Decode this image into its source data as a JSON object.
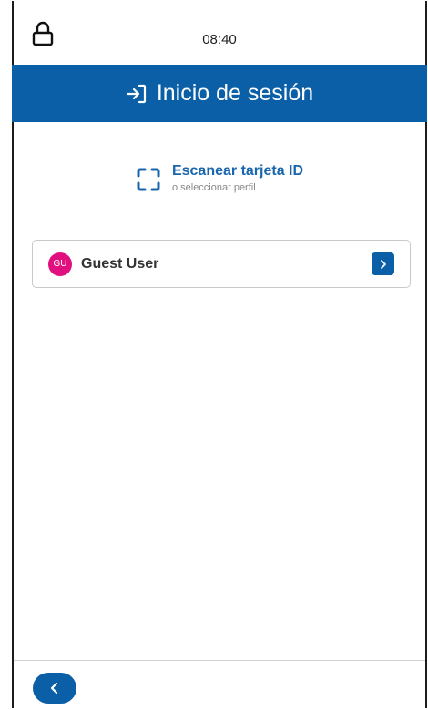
{
  "status_bar": {
    "time": "08:40",
    "lock_icon": "lock-icon"
  },
  "header": {
    "title": "Inicio de sesión",
    "icon": "login-arrow-icon",
    "color": "#0b5fa6"
  },
  "scan": {
    "title": "Escanear tarjeta ID",
    "subtitle": "o seleccionar perfil",
    "icon": "scan-frame-icon"
  },
  "profiles": [
    {
      "initials": "GU",
      "name": "Guest User",
      "avatar_color": "#e0107e",
      "action_icon": "chevron-right-icon"
    }
  ],
  "footer": {
    "back_icon": "chevron-left-icon"
  }
}
